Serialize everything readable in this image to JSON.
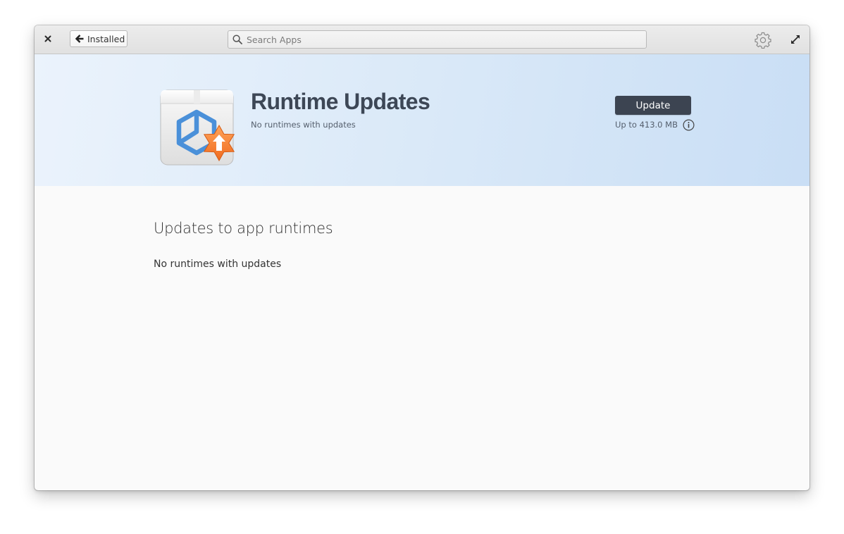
{
  "header": {
    "back_label": "Installed",
    "search_placeholder": "Search Apps"
  },
  "banner": {
    "title": "Runtime Updates",
    "subtitle": "No runtimes with updates",
    "update_label": "Update",
    "size_text": "Up to 413.0 MB"
  },
  "content": {
    "section_title": "Updates to app runtimes",
    "section_text": "No runtimes with updates"
  },
  "icons": {
    "close": "close-icon",
    "back": "arrow-left-icon",
    "search": "search-icon",
    "settings": "gear-icon",
    "maximize": "maximize-icon",
    "info": "info-icon",
    "app": "package-update-icon"
  },
  "colors": {
    "accent": "#3c4451",
    "title": "#3d4756",
    "badge": "#f37c29"
  }
}
